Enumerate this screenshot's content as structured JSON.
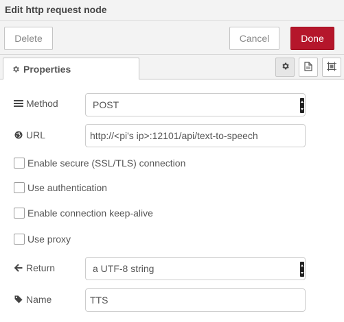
{
  "title": "Edit http request node",
  "toolbar": {
    "delete_label": "Delete",
    "cancel_label": "Cancel",
    "done_label": "Done"
  },
  "tabs": {
    "properties_label": "Properties"
  },
  "colors": {
    "done_bg": "#b5162b",
    "panel_bg": "#f3f3f3"
  },
  "form": {
    "method": {
      "label": "Method",
      "value": "POST",
      "icon": "list-icon"
    },
    "url": {
      "label": "URL",
      "value": "http://<pi's ip>:12101/api/text-to-speech",
      "icon": "globe-icon"
    },
    "secure": {
      "label": "Enable secure (SSL/TLS) connection",
      "checked": false
    },
    "auth": {
      "label": "Use authentication",
      "checked": false
    },
    "keepalive": {
      "label": "Enable connection keep-alive",
      "checked": false
    },
    "proxy": {
      "label": "Use proxy",
      "checked": false
    },
    "ret": {
      "label": "Return",
      "value": "a UTF-8 string",
      "icon": "arrow-left-icon"
    },
    "name": {
      "label": "Name",
      "value": "TTS",
      "icon": "tag-icon"
    }
  }
}
